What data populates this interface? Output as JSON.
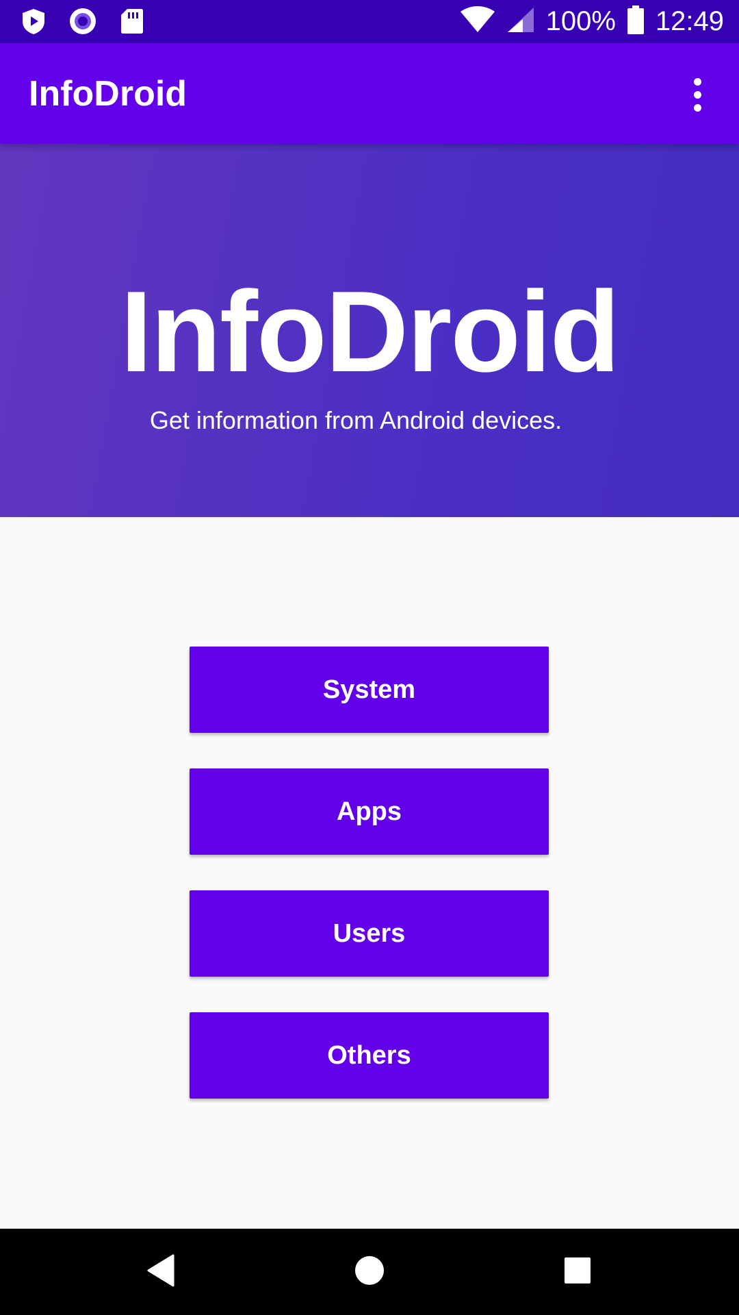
{
  "status_bar": {
    "battery_percent": "100%",
    "time": "12:49",
    "icons": [
      "shield-play-icon",
      "circle-record-icon",
      "sd-card-icon",
      "wifi-icon",
      "cell-signal-icon",
      "battery-icon"
    ]
  },
  "app_bar": {
    "title": "InfoDroid",
    "overflow_icon": "more-vert-icon"
  },
  "hero": {
    "title": "InfoDroid",
    "subtitle": "Get information from Android devices."
  },
  "menu": {
    "buttons": [
      {
        "label": "System"
      },
      {
        "label": "Apps"
      },
      {
        "label": "Users"
      },
      {
        "label": "Others"
      }
    ]
  },
  "nav_bar": {
    "icons": [
      "back-icon",
      "home-icon",
      "recents-icon"
    ]
  },
  "colors": {
    "primary": "#6200ea",
    "primary_dark": "#3700b3",
    "hero_gradient_start": "#6236bf",
    "hero_gradient_end": "#452bbf",
    "background": "#fafafa"
  }
}
